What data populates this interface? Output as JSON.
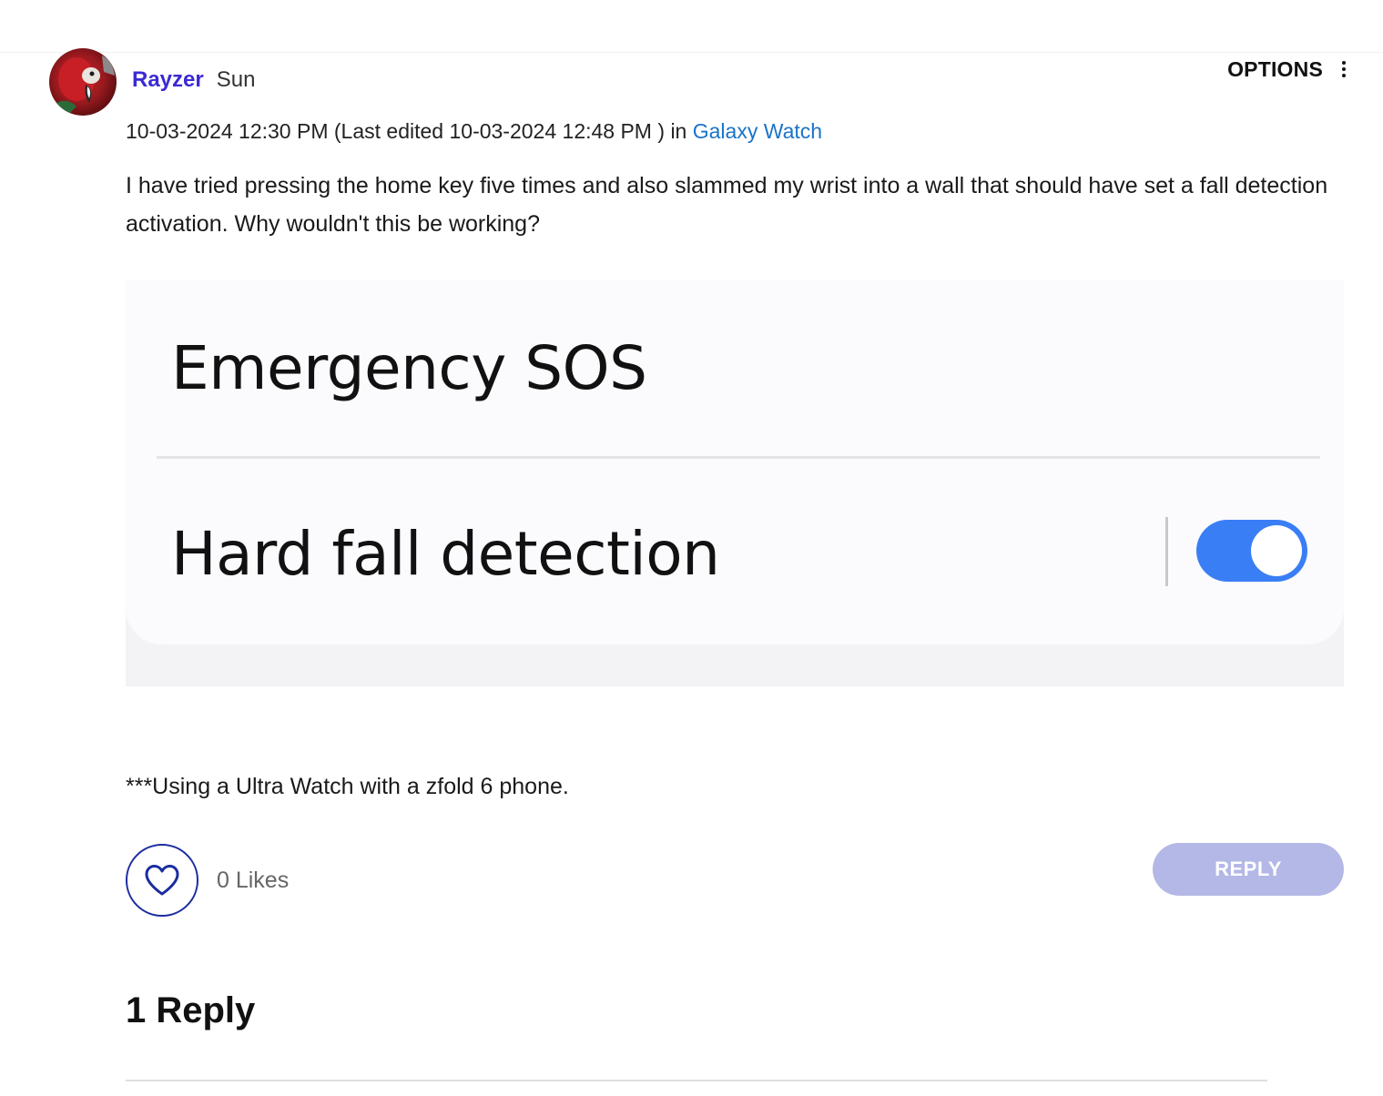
{
  "post": {
    "author": {
      "name": "Rayzer",
      "rank": "Sun",
      "avatar_icon": "parrot-avatar"
    },
    "options_label": "OPTIONS",
    "posted": "10-03-2024 12:30 PM",
    "edited_prefix": "(Last edited",
    "edited": "10-03-2024 12:48 PM",
    "edited_suffix": ")",
    "in_label": "in",
    "board": "Galaxy Watch",
    "body": "I have tried pressing the home key five times and also slammed my wrist into a wall that should have set a fall detection activation. Why wouldn't this be working?",
    "image": {
      "title": "Emergency SOS",
      "setting": "Hard fall detection",
      "toggle_on": true
    },
    "note": "***Using a Ultra Watch with a zfold 6 phone.",
    "likes": "0 Likes",
    "reply_label": "REPLY"
  },
  "replies": {
    "heading": "1 Reply"
  },
  "colors": {
    "author": "#3b2ad4",
    "link": "#1a73c8",
    "like_border": "#1c2da0",
    "reply_button": "#b3b8e6",
    "toggle": "#3a7ef5"
  }
}
